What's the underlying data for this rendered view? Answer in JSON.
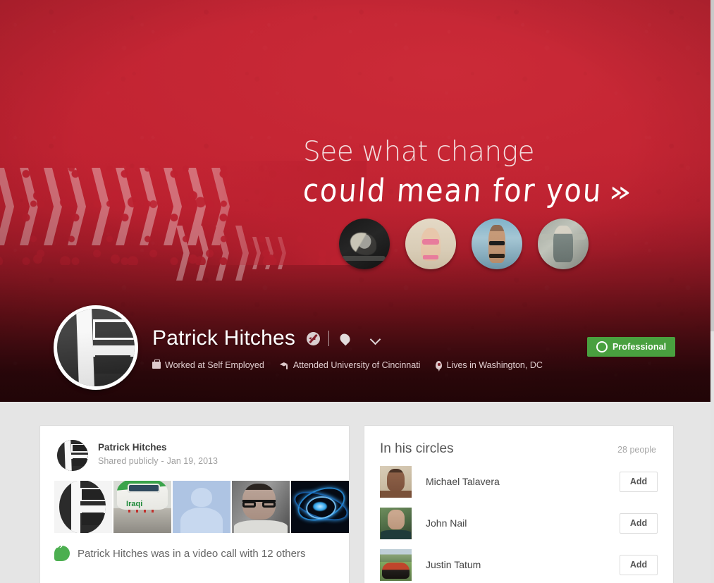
{
  "cover": {
    "headline_line1": "See what change",
    "headline_line2": "could mean for you",
    "headline_arrows": "»",
    "photo_labels": [
      "pushup-photo",
      "bikini-pose-photo",
      "beach-pose-photo",
      "gym-pose-photo"
    ],
    "bg_color": "#be2030",
    "bg_dark_color": "#2a0609"
  },
  "profile": {
    "name": "Patrick Hitches",
    "relationship_icon": "relationship-icon",
    "gender_icon": "gender-icon",
    "dropdown_icon": "chevron-down-icon",
    "meta": [
      {
        "icon": "work-icon",
        "text": "Worked at Self Employed"
      },
      {
        "icon": "school-icon",
        "text": "Attended University of Cincinnati"
      },
      {
        "icon": "place-icon",
        "text": "Lives in Washington, DC"
      }
    ],
    "badge": {
      "label": "Professional",
      "icon": "circle-outline-icon",
      "color": "#49a03f"
    }
  },
  "post": {
    "author": "Patrick Hitches",
    "visibility": "Shared publicly",
    "separator": "-",
    "date": "Jan 19, 2013",
    "thumbnails": [
      {
        "name": "thumb-logo",
        "alt": "Patrick Hitches logo"
      },
      {
        "name": "thumb-airplane",
        "alt": "Iraqi Airways plane",
        "caption": "Iraqi"
      },
      {
        "name": "thumb-default-avatar",
        "alt": "Default person silhouette"
      },
      {
        "name": "thumb-man-glasses",
        "alt": "Man with glasses"
      },
      {
        "name": "thumb-abstract",
        "alt": "Blue abstract light"
      }
    ],
    "footer_icon": "hangouts-icon",
    "footer_text": "Patrick Hitches was in a video call with 12 others"
  },
  "circles": {
    "title": "In his circles",
    "count": "28 people",
    "add_label": "Add",
    "people": [
      {
        "name": "Michael Talavera",
        "avatar": "michael-talavera-avatar"
      },
      {
        "name": "John Nail",
        "avatar": "john-nail-avatar"
      },
      {
        "name": "Justin Tatum",
        "avatar": "justin-tatum-avatar"
      }
    ]
  }
}
